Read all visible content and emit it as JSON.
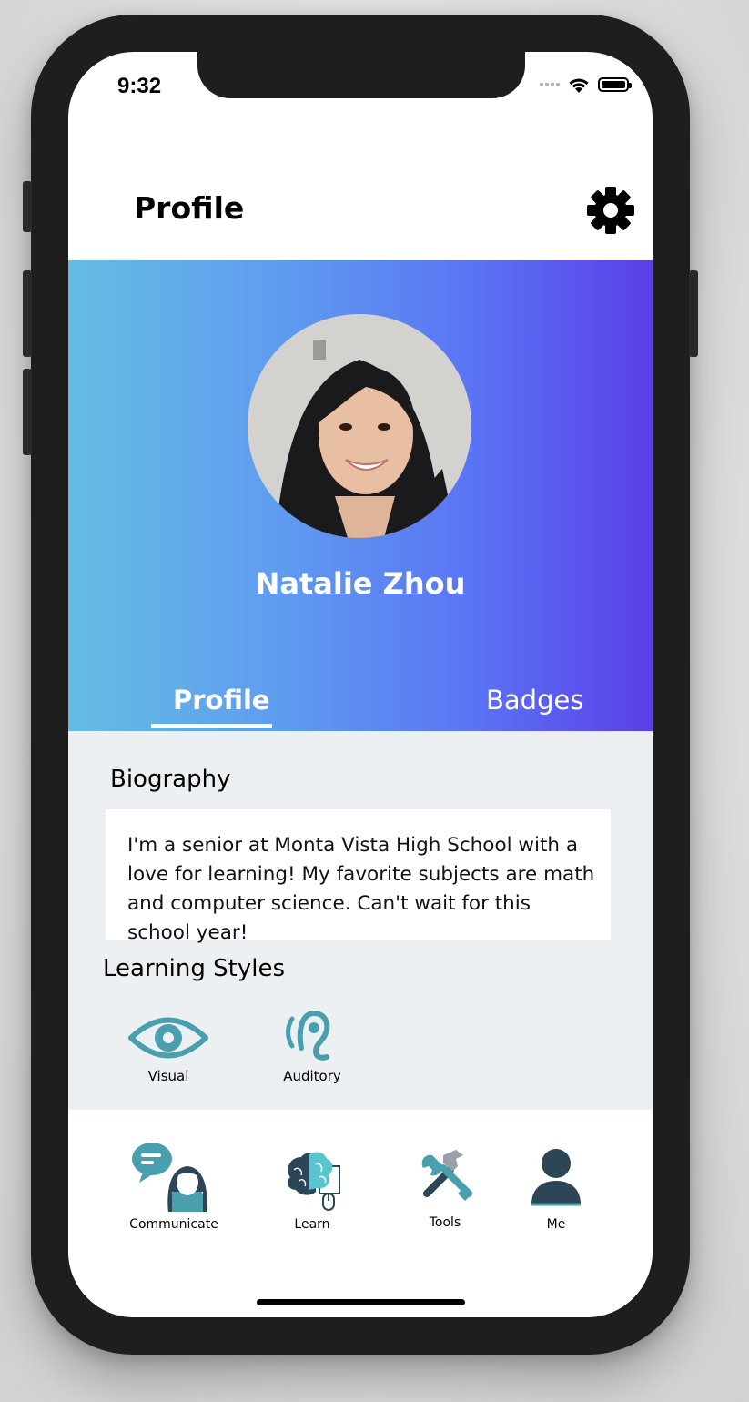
{
  "status_bar": {
    "time": "9:32"
  },
  "header": {
    "title": "Profile",
    "settings_icon": "gear-icon"
  },
  "profile": {
    "name": "Natalie Zhou",
    "avatar": "profile-photo"
  },
  "tabs": [
    {
      "label": "Profile",
      "active": true
    },
    {
      "label": "Badges",
      "active": false
    }
  ],
  "biography": {
    "title": "Biography",
    "text": "I'm a senior at Monta Vista High School with a love for learning! My favorite subjects are math and computer science. Can't wait for this school year!"
  },
  "learning_styles": {
    "title": "Learning Styles",
    "items": [
      {
        "label": "Visual",
        "icon": "eye-icon"
      },
      {
        "label": "Auditory",
        "icon": "ear-icon"
      }
    ]
  },
  "tab_bar": {
    "items": [
      {
        "label": "Communicate",
        "icon": "communicate-icon"
      },
      {
        "label": "Learn",
        "icon": "brain-icon"
      },
      {
        "label": "Tools",
        "icon": "tools-icon"
      },
      {
        "label": "Me",
        "icon": "person-icon"
      }
    ]
  },
  "colors": {
    "gradient_start": "#65bde2",
    "gradient_end": "#5a3ee8",
    "accent_teal": "#4a9fae",
    "dark_navy": "#2c4657",
    "content_bg": "#edf0f2"
  }
}
